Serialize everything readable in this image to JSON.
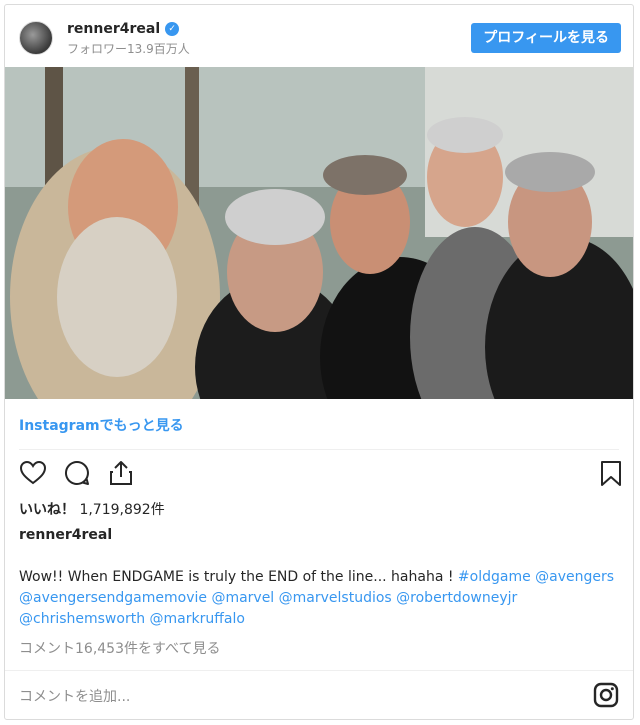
{
  "header": {
    "username": "renner4real",
    "followers": "フォロワー13.9百万人",
    "profile_button": "プロフィールを見る"
  },
  "post": {
    "more_link": "Instagramでもっと見る",
    "likes_label": "いいね！",
    "likes_count": "1,719,892件",
    "caption_user": "renner4real",
    "caption_text": "Wow!! When ENDGAME is truly the END of the line... hahaha ! ",
    "hashtags": [
      "#oldgame",
      "@avengers",
      "@avengersendgamemovie",
      "@marvel",
      "@marvelstudios",
      "@robertdowneyjr",
      "@chrishemsworth",
      "@markruffalo"
    ],
    "view_comments": "コメント16,453件をすべて見る",
    "comment_placeholder": "コメントを追加..."
  },
  "icons": [
    "heart-icon",
    "comment-icon",
    "share-icon",
    "bookmark-icon",
    "instagram-icon",
    "verified-badge-icon"
  ],
  "colors": {
    "accent": "#3897f0",
    "text": "#262626",
    "muted": "#8e8e8e"
  }
}
